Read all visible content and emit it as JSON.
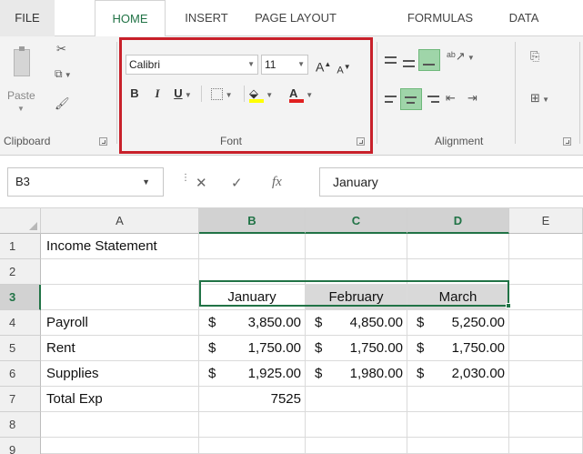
{
  "tabs": [
    {
      "label": "FILE"
    },
    {
      "label": "HOME",
      "active": true
    },
    {
      "label": "INSERT"
    },
    {
      "label": "PAGE LAYOUT"
    },
    {
      "label": "FORMULAS"
    },
    {
      "label": "DATA"
    }
  ],
  "ribbon": {
    "clipboard": {
      "paste_label": "Paste",
      "group_label": "Clipboard"
    },
    "font": {
      "font_name": "Calibri",
      "font_size": "11",
      "bold": "B",
      "italic": "I",
      "underline": "U",
      "grow": "A",
      "shrink": "A",
      "font_color": "A",
      "group_label": "Font"
    },
    "alignment": {
      "group_label": "Alignment"
    }
  },
  "formula_bar": {
    "name_box": "B3",
    "fx": "fx",
    "value": "January"
  },
  "grid": {
    "columns": [
      "A",
      "B",
      "C",
      "D",
      "E"
    ],
    "highlighted_columns": [
      "B",
      "C",
      "D"
    ],
    "rows": [
      "1",
      "2",
      "3",
      "4",
      "5",
      "6",
      "7",
      "8",
      "9"
    ],
    "cells": {
      "A1": "Income Statement",
      "A4": "Payroll",
      "A5": "Rent",
      "A6": "Supplies",
      "A7": "Total Exp",
      "B3": "January",
      "C3": "February",
      "D3": "March",
      "B4": {
        "cur": "$",
        "num": "3,850.00"
      },
      "C4": {
        "cur": "$",
        "num": "4,850.00"
      },
      "D4": {
        "cur": "$",
        "num": "5,250.00"
      },
      "B5": {
        "cur": "$",
        "num": "1,750.00"
      },
      "C5": {
        "cur": "$",
        "num": "1,750.00"
      },
      "D5": {
        "cur": "$",
        "num": "1,750.00"
      },
      "B6": {
        "cur": "$",
        "num": "1,925.00"
      },
      "C6": {
        "cur": "$",
        "num": "1,980.00"
      },
      "D6": {
        "cur": "$",
        "num": "2,030.00"
      },
      "B7": "7525"
    },
    "selected_range": "B3:D3"
  },
  "colors": {
    "accent": "#217346",
    "highlight_box": "#c8202a",
    "fill_color": "#ffff00",
    "font_color": "#e02020",
    "header_fill": "#d9d9d9"
  }
}
